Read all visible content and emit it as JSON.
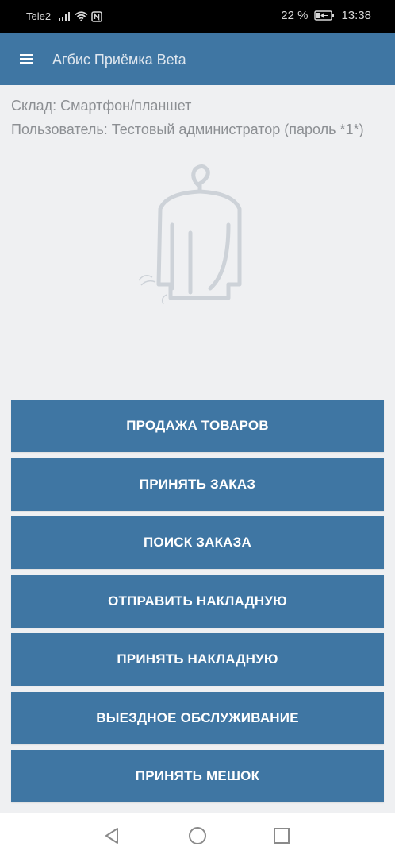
{
  "status_bar": {
    "carrier": "Tele2",
    "battery": "22 %",
    "time": "13:38",
    "icons": [
      "signal-icon",
      "wifi-icon",
      "nfc-icon",
      "battery-icon"
    ]
  },
  "app_bar": {
    "title": "Агбис Приёмка Beta",
    "menu_icon": "hamburger-menu-icon",
    "color": "#3f76a3"
  },
  "info": {
    "warehouse": "Склад: Смартфон/планшет",
    "user": "Пользователь: Тестовый администратор (пароль *1*)"
  },
  "illustration": {
    "icon": "clothes-on-hanger-icon"
  },
  "actions": [
    {
      "label": "ПРОДАЖА ТОВАРОВ"
    },
    {
      "label": "ПРИНЯТЬ ЗАКАЗ"
    },
    {
      "label": "ПОИСК ЗАКАЗА"
    },
    {
      "label": "ОТПРАВИТЬ НАКЛАДНУЮ"
    },
    {
      "label": "ПРИНЯТЬ НАКЛАДНУЮ"
    },
    {
      "label": "ВЫЕЗДНОЕ ОБСЛУЖИВАНИЕ"
    },
    {
      "label": "ПРИНЯТЬ МЕШОК"
    }
  ],
  "nav_bar": {
    "icons": [
      "back-icon",
      "home-icon",
      "recent-apps-icon"
    ]
  }
}
